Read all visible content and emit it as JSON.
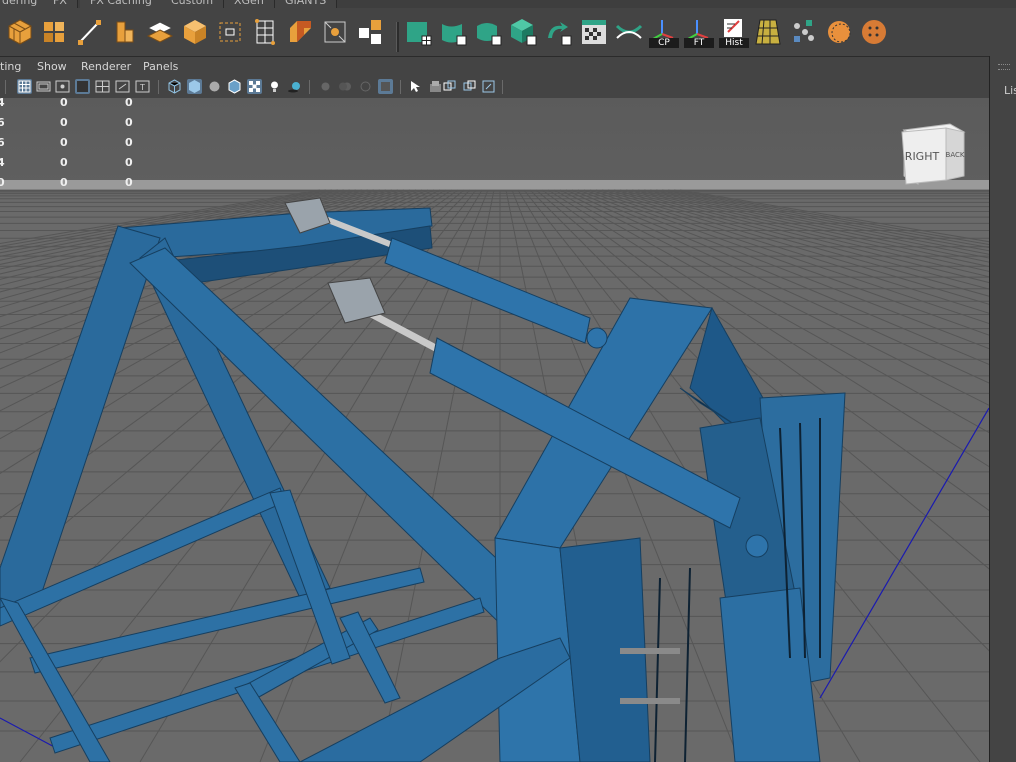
{
  "shelf_tabs": [
    "dering",
    "FX",
    "FX Caching",
    "Custom",
    "XGen",
    "GIANTS"
  ],
  "shelf_icons": [
    {
      "name": "polygon-sphere-icon"
    },
    {
      "name": "polygon-cube-icon"
    },
    {
      "name": "curve-tool-icon"
    },
    {
      "name": "polygon-pipe-icon"
    },
    {
      "name": "polygon-plane-icon"
    },
    {
      "name": "nurbs-cube-icon"
    },
    {
      "name": "bounding-box-icon"
    },
    {
      "name": "lattice-icon"
    },
    {
      "name": "bevel-icon"
    },
    {
      "name": "select-box-icon"
    },
    {
      "name": "separate-icon"
    },
    {
      "name": "uv-plane-icon"
    },
    {
      "name": "uv-cylinder-icon"
    },
    {
      "name": "uv-sphere-icon"
    },
    {
      "name": "uv-cube-icon"
    },
    {
      "name": "uv-transfer-icon"
    },
    {
      "name": "checker-icon"
    },
    {
      "name": "uv-cut-icon"
    },
    {
      "name": "center-pivot-icon",
      "sub": "CP"
    },
    {
      "name": "freeze-transform-icon",
      "sub": "FT"
    },
    {
      "name": "delete-history-icon",
      "sub": "Hist"
    },
    {
      "name": "texture-grid-icon"
    },
    {
      "name": "scatter-icon"
    },
    {
      "name": "circle-dashed-icon"
    },
    {
      "name": "orange-dots-icon"
    }
  ],
  "panel_menu": [
    "ting",
    "Show",
    "Renderer",
    "Panels"
  ],
  "right_dock_label": "Lis",
  "hud": {
    "col_a": [
      "4",
      "6",
      "6",
      "4",
      "0"
    ],
    "col_b": [
      "0",
      "0",
      "0",
      "0",
      "0"
    ],
    "col_c": [
      "0",
      "0",
      "0",
      "0",
      "0"
    ]
  },
  "view_cube": {
    "right": "RIGHT",
    "back": "BACK"
  },
  "colors": {
    "model": "#2a6a9c",
    "background": "#5a5a5a",
    "grid": "#6d6d6d",
    "accent_green": "#2fa487",
    "accent_orange": "#d77b35"
  }
}
